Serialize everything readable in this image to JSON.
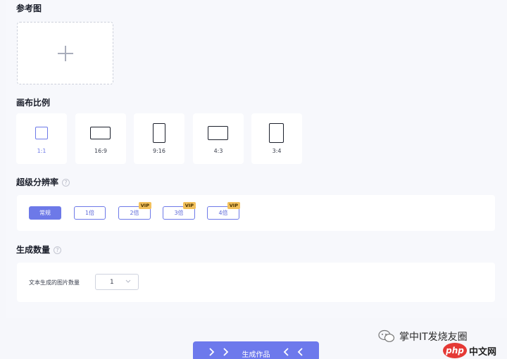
{
  "reference": {
    "title": "参考图",
    "upload_icon": "plus-icon"
  },
  "ratio": {
    "title": "画布比例",
    "selected": "1:1",
    "options": [
      {
        "label": "1:1"
      },
      {
        "label": "16:9"
      },
      {
        "label": "9:16"
      },
      {
        "label": "4:3"
      },
      {
        "label": "3:4"
      }
    ]
  },
  "resolution": {
    "title": "超级分辨率",
    "help_icon": "question-icon",
    "selected": "常规",
    "options": [
      {
        "label": "常规",
        "vip": ""
      },
      {
        "label": "1倍",
        "vip": ""
      },
      {
        "label": "2倍",
        "vip": "VIP"
      },
      {
        "label": "3倍",
        "vip": "VIP"
      },
      {
        "label": "4倍",
        "vip": "VIP"
      }
    ]
  },
  "count": {
    "title": "生成数量",
    "help_icon": "question-icon",
    "label": "文本生成的图片数量",
    "value": "1"
  },
  "generate": {
    "label": "生成作品"
  },
  "watermark": {
    "text": "掌中IT发烧友圈",
    "php_text": "php",
    "site_text": "中文网"
  },
  "colors": {
    "accent": "#6d79e8",
    "vip": "#f2c05b"
  }
}
